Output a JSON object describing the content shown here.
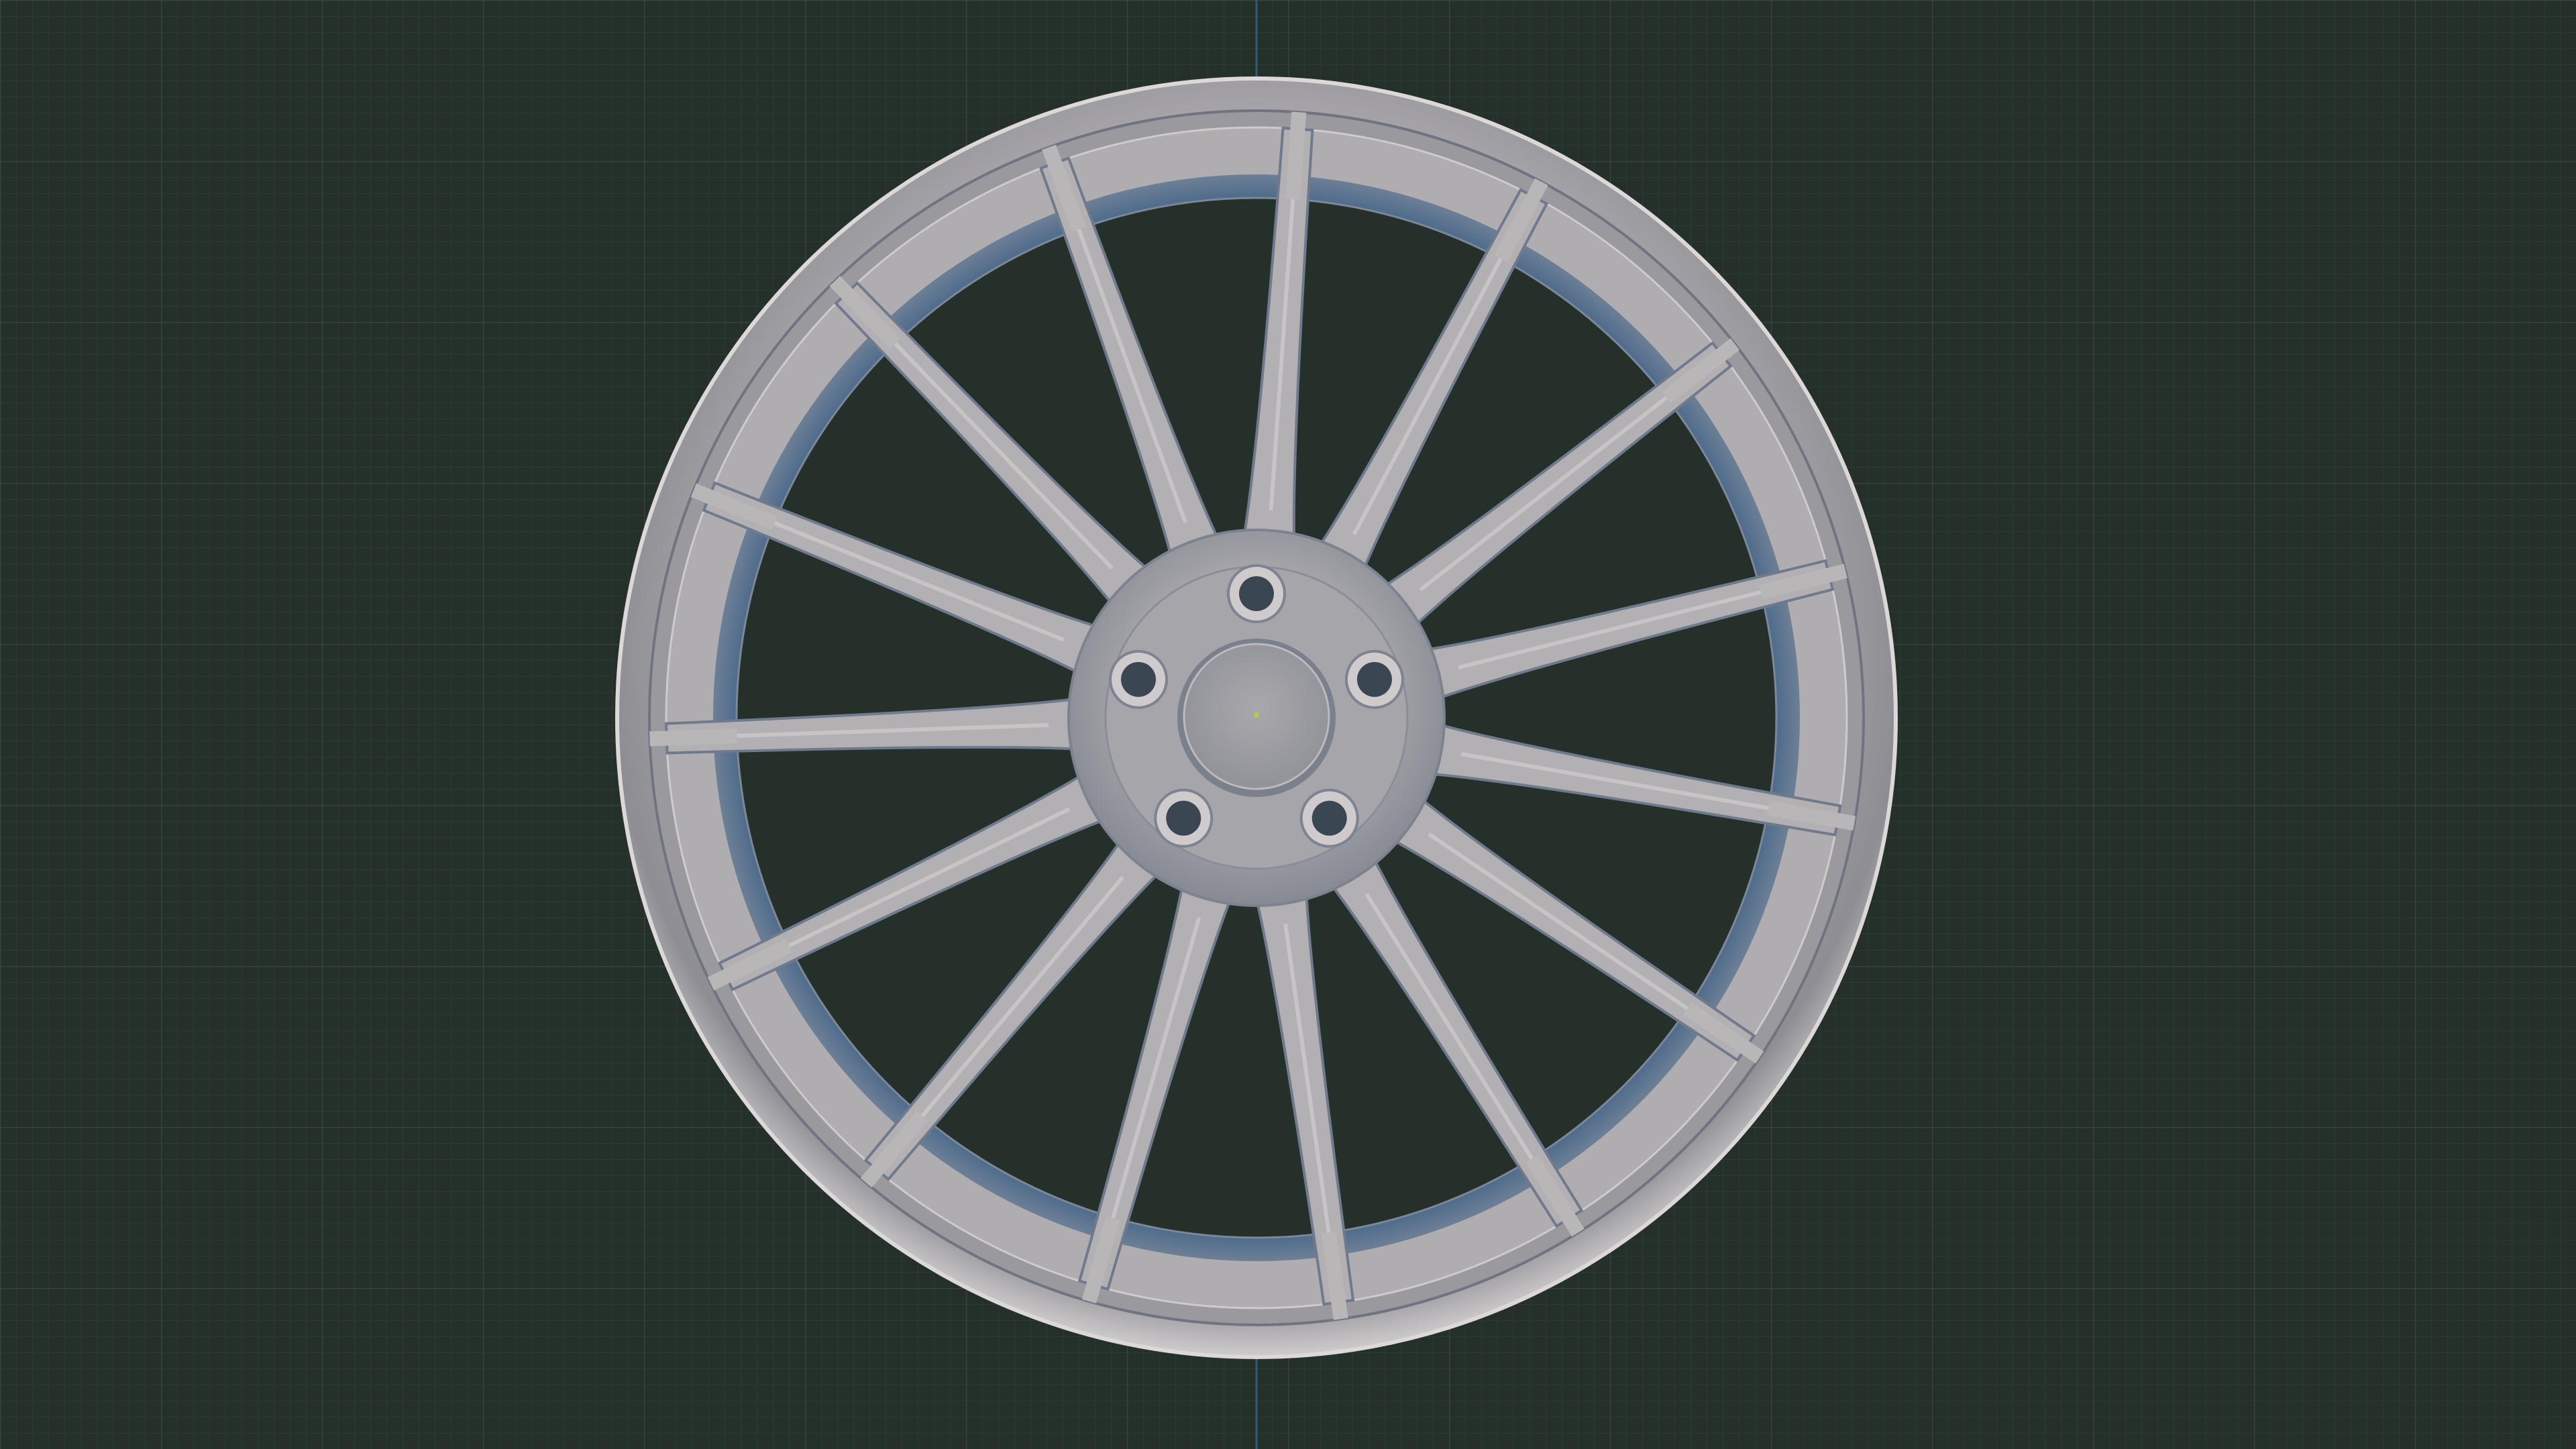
{
  "viewport": {
    "background_color": "#243029",
    "grid_minor_color": "#2c3833",
    "grid_major_color": "#34413b",
    "axis_color": "#2f5d78",
    "origin_marker_color": "#b8c94a"
  },
  "model": {
    "name": "wheel-rim",
    "material_color": "#a9a7ab",
    "spoke_count": 15,
    "lug_hole_count": 5
  }
}
